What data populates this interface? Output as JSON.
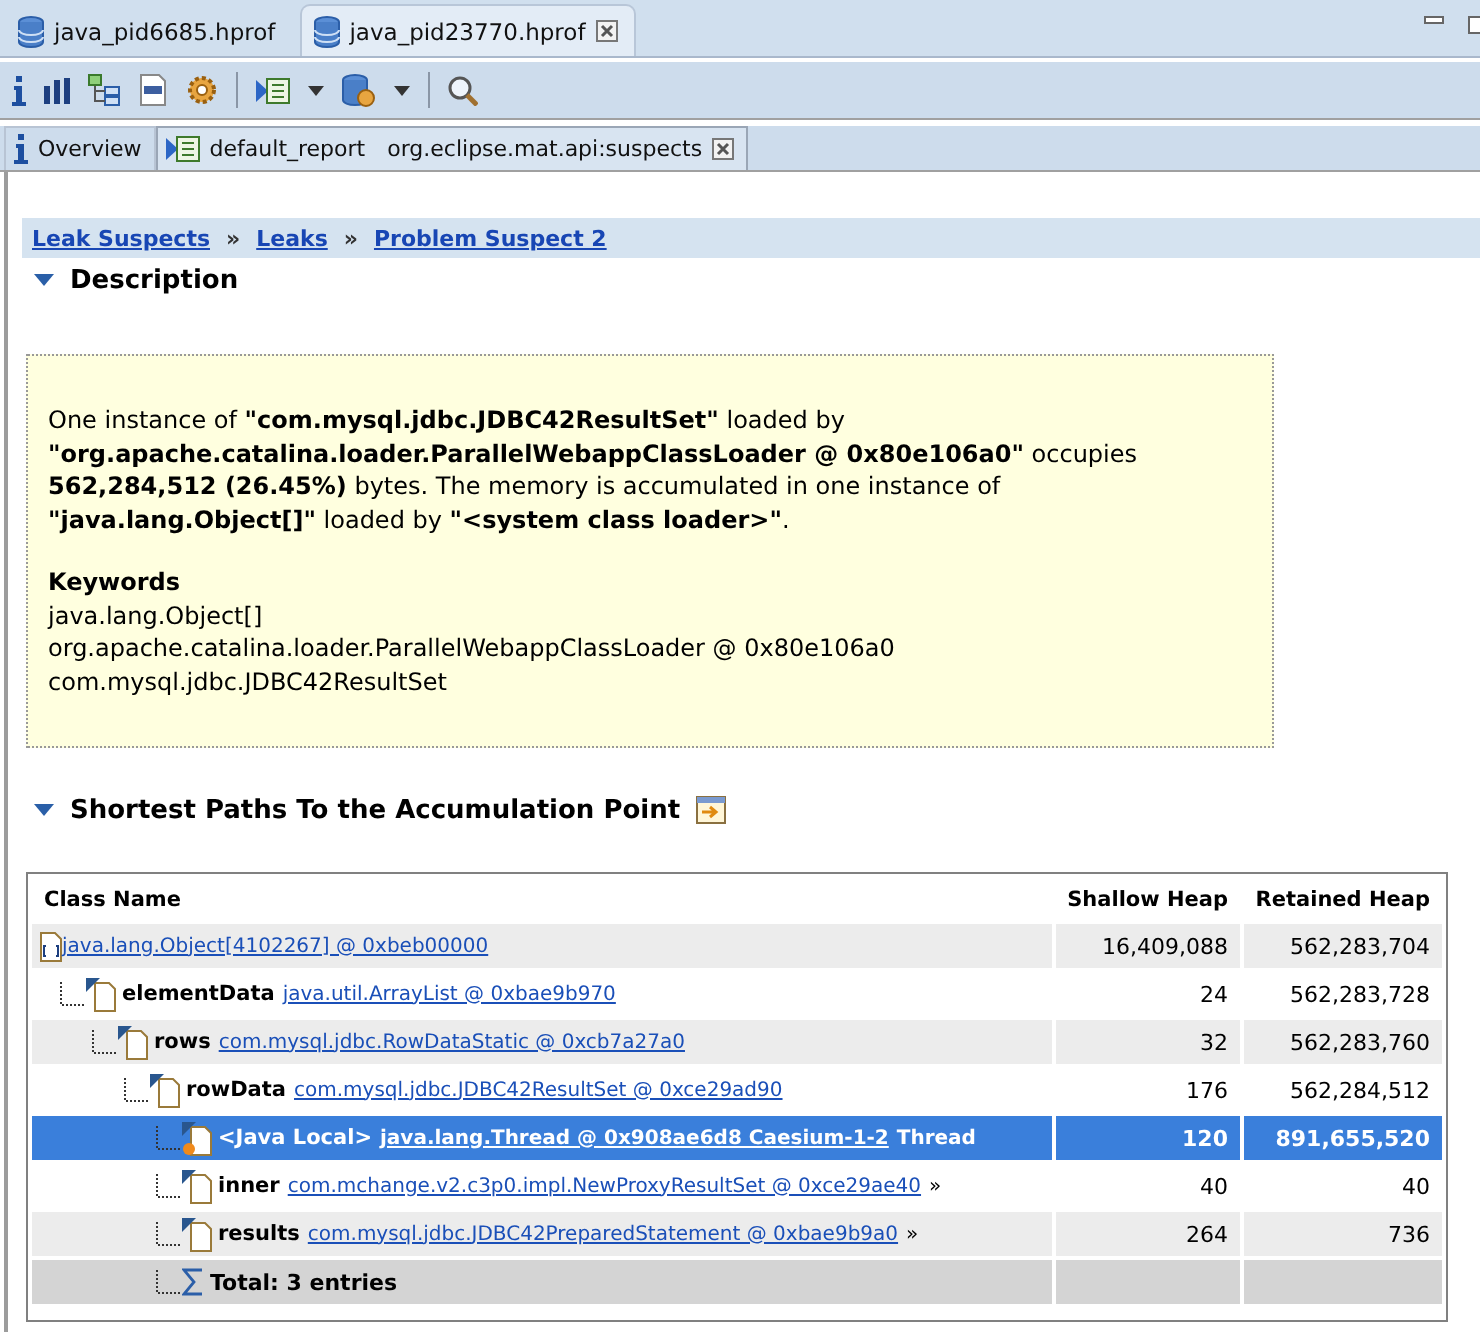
{
  "editor_tabs": [
    {
      "label": "java_pid6685.hprof",
      "selected": false
    },
    {
      "label": "java_pid23770.hprof",
      "selected": true
    }
  ],
  "view_tabs": [
    {
      "label": "Overview",
      "kind": "info",
      "selected": false
    },
    {
      "label": "default_report",
      "detail": "org.eclipse.mat.api:suspects",
      "kind": "report",
      "selected": true
    }
  ],
  "breadcrumb": [
    {
      "label": "Leak Suspects"
    },
    {
      "separator": "»",
      "label": "Leaks"
    },
    {
      "separator": "»",
      "label": "Problem Suspect 2"
    }
  ],
  "description": {
    "heading": "Description",
    "expanded": true,
    "text": "One instance of **\"com.mysql.jdbc.JDBC42ResultSet\"** loaded by **\"org.apache.catalina.loader.ParallelWebappClassLoader @ 0x80e106a0\"** occupies **562,284,512 (26.45%)** bytes. The memory is accumulated in one instance of **\"java.lang.Object[]\"** loaded by **\"<system class loader>\"**.",
    "keywords_heading": "Keywords",
    "keywords": [
      "java.lang.Object[]",
      "org.apache.catalina.loader.ParallelWebappClassLoader @ 0x80e106a0",
      "com.mysql.jdbc.JDBC42ResultSet"
    ]
  },
  "paths": {
    "heading": "Shortest Paths To the Accumulation Point",
    "expanded": true,
    "table": {
      "columns": [
        "Class Name",
        "Shallow Heap",
        "Retained Heap"
      ],
      "rows": [
        {
          "kind": "array",
          "object": "java.lang.Object[4102267] @ 0xbeb00000",
          "shallow": "16,409,088",
          "retained": "562,283,704",
          "selected": false,
          "children": [
            {
              "kind": "instance",
              "field": "elementData",
              "object": "java.util.ArrayList @ 0xbae9b970",
              "shallow": "24",
              "retained": "562,283,728",
              "selected": false,
              "children": [
                {
                  "kind": "instance",
                  "field": "rows",
                  "object": "com.mysql.jdbc.RowDataStatic @ 0xcb7a27a0",
                  "shallow": "32",
                  "retained": "562,283,760",
                  "selected": false,
                  "children": [
                    {
                      "kind": "instance",
                      "field": "rowData",
                      "object": "com.mysql.jdbc.JDBC42ResultSet @ 0xce29ad90",
                      "shallow": "176",
                      "retained": "562,284,512",
                      "selected": false,
                      "children": [
                        {
                          "kind": "local",
                          "field": "<Java Local>",
                          "object": "java.lang.Thread @ 0x908ae6d8 Caesium-1-2",
                          "suffix": "Thread",
                          "shallow": "120",
                          "retained": "891,655,520",
                          "selected": true
                        },
                        {
                          "kind": "instance",
                          "field": "inner",
                          "object": "com.mchange.v2.c3p0.impl.NewProxyResultSet @ 0xce29ae40",
                          "suffix": "»",
                          "shallow": "40",
                          "retained": "40",
                          "selected": false
                        },
                        {
                          "kind": "instance",
                          "field": "results",
                          "object": "com.mysql.jdbc.JDBC42PreparedStatement @ 0xbae9b9a0",
                          "suffix": "»",
                          "shallow": "264",
                          "retained": "736",
                          "selected": false
                        },
                        {
                          "kind": "total",
                          "label": "Total: 3 entries"
                        }
                      ]
                    }
                  ]
                }
              ]
            }
          ]
        }
      ]
    }
  }
}
